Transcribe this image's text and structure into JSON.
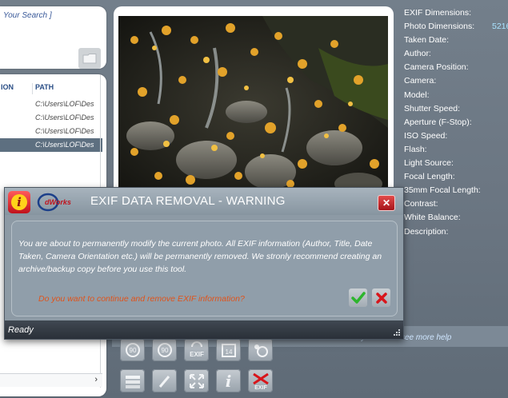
{
  "search": {
    "placeholder": "Your Search ]"
  },
  "file_list": {
    "columns": [
      "ION",
      "PATH"
    ],
    "rows": [
      {
        "path": "C:\\Users\\LOF\\Des"
      },
      {
        "path": "C:\\Users\\LOF\\Des"
      },
      {
        "path": "C:\\Users\\LOF\\Des"
      },
      {
        "path": "C:\\Users\\LOF\\Des",
        "selected": true
      }
    ],
    "scroll_arrow": "›"
  },
  "exif": {
    "fields": [
      {
        "label": "EXIF Dimensions:",
        "value": ""
      },
      {
        "label": "Photo Dimensions:",
        "value": "5216"
      },
      {
        "label": "Taken Date:",
        "value": ""
      },
      {
        "label": "Author:",
        "value": ""
      },
      {
        "label": "Camera Position:",
        "value": ""
      },
      {
        "label": "Camera:",
        "value": ""
      },
      {
        "label": "Model:",
        "value": ""
      },
      {
        "label": "Shutter Speed:",
        "value": ""
      },
      {
        "label": "Aperture (F-Stop):",
        "value": ""
      },
      {
        "label": "ISO Speed:",
        "value": ""
      },
      {
        "label": "Flash:",
        "value": ""
      },
      {
        "label": "Light Source:",
        "value": ""
      },
      {
        "label": "Focal Length:",
        "value": ""
      },
      {
        "label": "35mm Focal Length:",
        "value": ""
      },
      {
        "label": "Contrast:",
        "value": ""
      },
      {
        "label": "White Balance:",
        "value": ""
      },
      {
        "label": "Description:",
        "value": ""
      }
    ]
  },
  "toolbar": {
    "help_text": "Please mouse over any button to see more help",
    "exif_label": "EXIF",
    "info_label": "i",
    "calendar_label": "14",
    "rotate_label": "90"
  },
  "dialog": {
    "logo_text": "dWorks",
    "title": "EXIF DATA REMOVAL - WARNING",
    "close_label": "✕",
    "info_glyph": "i",
    "message": "You are about to permanently modify the current photo. All EXIF information (Author, Title, Date Taken, Camera Orientation etc.) will be permanently removed. We stronly recommend creating an archive/backup copy before you use this tool.",
    "question": "Do you want to continue and remove EXIF information?",
    "status": "Ready"
  },
  "colors": {
    "background": "#6f7a86",
    "dialog_warning_text": "#e0531a",
    "ok_green": "#2db52d",
    "cancel_red": "#d8151b",
    "exif_value": "#a9e3ff"
  }
}
